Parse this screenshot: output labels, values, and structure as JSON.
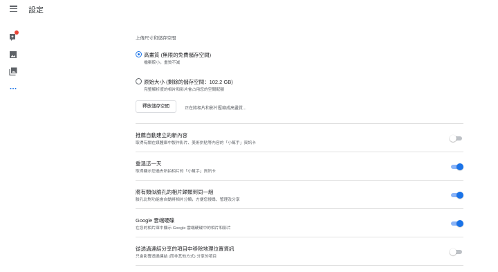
{
  "app": {
    "title": "設定"
  },
  "rail": {
    "items": [
      {
        "icon": "assistant-icon",
        "has_notification": true
      },
      {
        "icon": "photos-icon"
      },
      {
        "icon": "albums-icon"
      },
      {
        "icon": "more-icon"
      }
    ]
  },
  "upload": {
    "section_label": "上傳尺寸和儲存空間",
    "options": [
      {
        "title": "高畫質 (無限的免費儲存空間)",
        "subtitle": "檔案較小，畫質不減",
        "selected": true
      },
      {
        "title": "原始大小 (剩餘的儲存空間：102.2 GB)",
        "subtitle": "完整解析度的相片和影片會占用您的空間配額",
        "selected": false
      }
    ],
    "recover_button": "釋放儲存空間",
    "recover_note": "正在將相片和影片壓縮成高畫質..."
  },
  "settings": [
    {
      "title": "推薦自動建立的新內容",
      "subtitle": "取得有關在媒體庫中製作影片、美術拼貼等內容的「小幫手」資訊卡",
      "enabled": false
    },
    {
      "title": "重溫這一天",
      "subtitle": "取得顯示您過去所拍相片的「小幫手」資訊卡",
      "enabled": true
    },
    {
      "title": "將有類似臉孔的相片歸類到同一組",
      "subtitle": "臉孔比對功能會自動將相片分類，方便您搜尋、管理及分享",
      "enabled": true
    },
    {
      "title": "Google 雲端硬碟",
      "subtitle": "在您的相片庫中顯示 Google 雲端硬碟中的相片和影片",
      "enabled": true
    },
    {
      "title": "從透過連結分享的項目中移除地理位置資訊",
      "subtitle": "只會影響透過連結 (而非其他方式) 分享的項目",
      "enabled": false
    }
  ],
  "colors": {
    "accent": "#1a73e8",
    "accent_light": "#8ab4f8",
    "notification": "#ea4335",
    "text_secondary": "#5f6368"
  }
}
